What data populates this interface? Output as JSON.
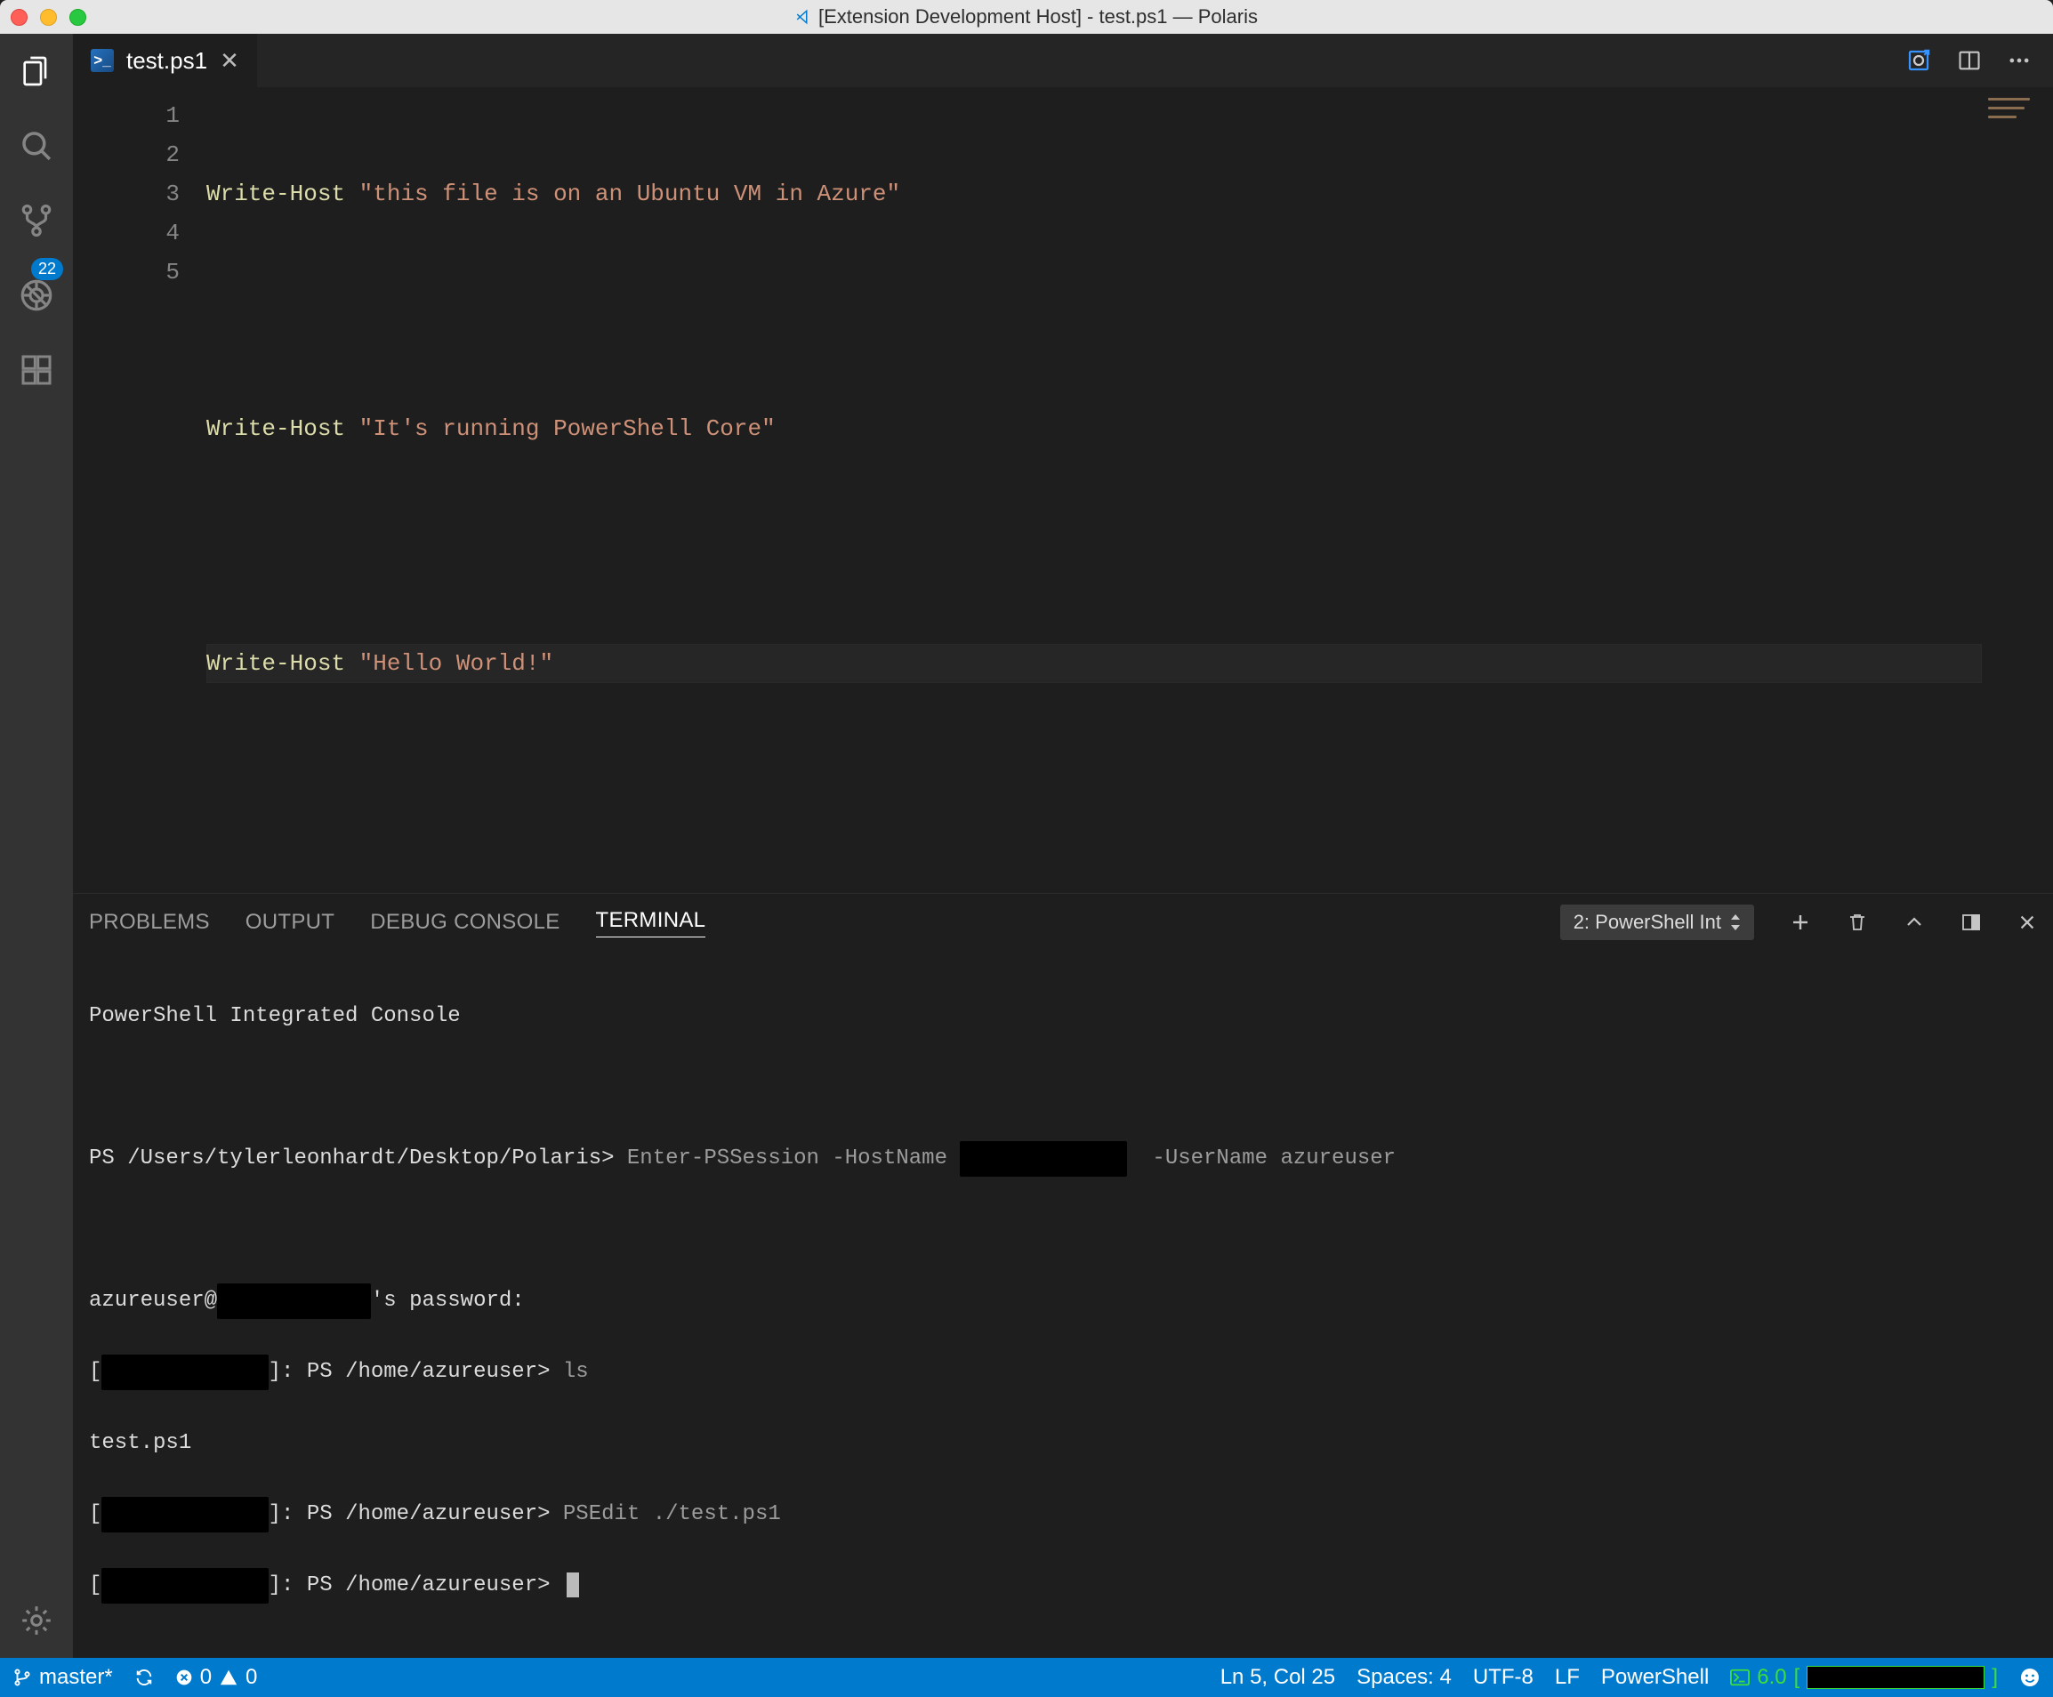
{
  "window": {
    "title": "[Extension Development Host] - test.ps1 — Polaris"
  },
  "activitybar": {
    "scm_badge": "22"
  },
  "tabs": {
    "tab1": {
      "label": "test.ps1"
    }
  },
  "editor": {
    "lines": {
      "n1": "1",
      "n2": "2",
      "n3": "3",
      "n4": "4",
      "n5": "5"
    },
    "code": {
      "l1_cmd": "Write-Host",
      "l1_str": "\"this file is on an Ubuntu VM in Azure\"",
      "l3_cmd": "Write-Host",
      "l3_str": "\"It's running PowerShell Core\"",
      "l5_cmd": "Write-Host",
      "l5_str": "\"Hello World!\""
    }
  },
  "panel": {
    "tabs": {
      "problems": "PROBLEMS",
      "output": "OUTPUT",
      "debug": "DEBUG CONSOLE",
      "terminal": "TERMINAL"
    },
    "terminal_selector": "2: PowerShell Int",
    "terminal": {
      "header": "PowerShell Integrated Console",
      "prompt1_prefix": "PS /Users/tylerleonhardt/Desktop/Polaris>",
      "prompt1_cmd_a": "Enter-PSSession -HostName ",
      "prompt1_cmd_b": " -UserName azureuser",
      "line_pwa": "azureuser@",
      "line_pwb": "'s password:",
      "br_open": "[",
      "br_close": "]:",
      "remote_prompt": " PS /home/azureuser>",
      "cmd_ls": "ls",
      "out_ls": "test.ps1",
      "cmd_psedit": "PSEdit ./test.ps1"
    }
  },
  "status": {
    "branch": "master*",
    "errors": "0",
    "warnings": "0",
    "ln_col": "Ln 5, Col 25",
    "spaces": "Spaces: 4",
    "encoding": "UTF-8",
    "eol": "LF",
    "language": "PowerShell",
    "ps_version": "6.0"
  }
}
